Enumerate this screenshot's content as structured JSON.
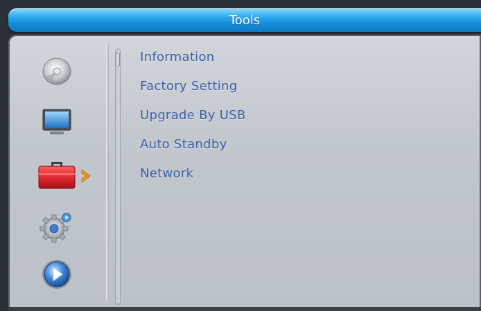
{
  "header": {
    "title": "Tools"
  },
  "sidebar": {
    "items": [
      {
        "icon": "disc-icon",
        "active": false
      },
      {
        "icon": "tv-icon",
        "active": false
      },
      {
        "icon": "toolbox-icon",
        "active": true
      },
      {
        "icon": "gear-icon",
        "active": false
      },
      {
        "icon": "play-icon",
        "active": false
      }
    ]
  },
  "menu": {
    "items": [
      {
        "label": "Information"
      },
      {
        "label": "Factory Setting"
      },
      {
        "label": "Upgrade By USB"
      },
      {
        "label": "Auto Standby"
      },
      {
        "label": "Network"
      }
    ]
  },
  "colors": {
    "title_bar": "#1690dc",
    "panel_bg": "#c2c7cd",
    "menu_text": "#3b5fa9",
    "active_arrow": "#f59a12",
    "toolbox_red": "#d9232b"
  }
}
